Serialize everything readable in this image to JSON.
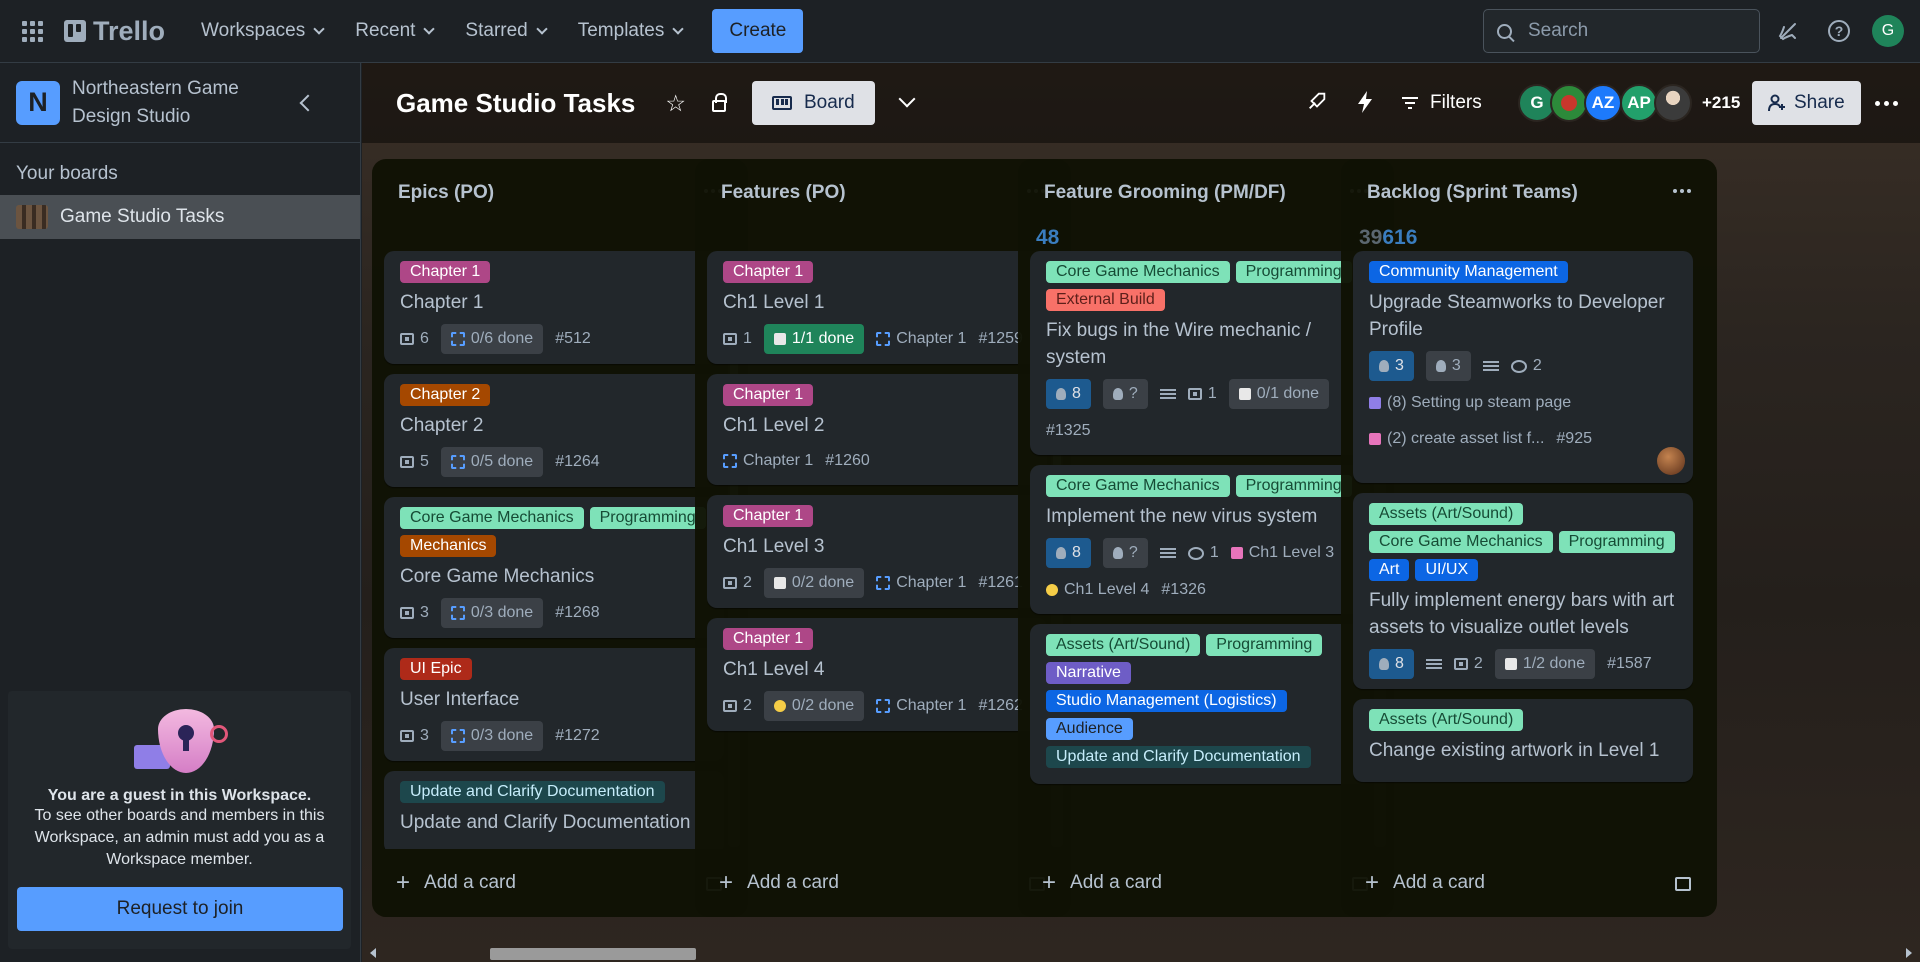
{
  "topnav": {
    "logo": "Trello",
    "menus": [
      {
        "label": "Workspaces"
      },
      {
        "label": "Recent"
      },
      {
        "label": "Starred"
      },
      {
        "label": "Templates"
      }
    ],
    "create_label": "Create",
    "search_placeholder": "Search",
    "user_initial": "G",
    "icons": [
      "apps-icon",
      "bell-icon",
      "help-icon"
    ]
  },
  "sidebar": {
    "workspace_initial": "N",
    "workspace_name": "Northeastern Game Design Studio",
    "your_boards": "Your boards",
    "boards": [
      {
        "label": "Game Studio Tasks"
      }
    ],
    "guest": {
      "title": "You are a guest in this Workspace.",
      "text": "To see other boards and members in this Workspace, an admin must add you as a Workspace member.",
      "button": "Request to join"
    }
  },
  "board": {
    "title": "Game Studio Tasks",
    "view_label": "Board",
    "filters_label": "Filters",
    "members": [
      "G",
      "",
      "AZ",
      "AP",
      ""
    ],
    "more_members": "+215",
    "share_label": "Share",
    "add_card_label": "Add a card",
    "lists": [
      {
        "title": "Epics (PO)",
        "count": "",
        "count2": "",
        "cards": [
          {
            "labels": [
              {
                "text": "Chapter 1",
                "color": "purple"
              }
            ],
            "title": "Chapter 1",
            "badges": [
              {
                "type": "cards",
                "text": "6"
              },
              {
                "type": "hier",
                "text": "0/6 done",
                "pill": "dark"
              },
              {
                "type": "text",
                "text": "#512"
              }
            ]
          },
          {
            "labels": [
              {
                "text": "Chapter 2",
                "color": "orange"
              }
            ],
            "title": "Chapter 2",
            "badges": [
              {
                "type": "cards",
                "text": "5"
              },
              {
                "type": "hier",
                "text": "0/5 done",
                "pill": "dark"
              },
              {
                "type": "text",
                "text": "#1264"
              }
            ]
          },
          {
            "labels": [
              {
                "text": "Core Game Mechanics",
                "color": "green"
              },
              {
                "text": "Programming",
                "color": "green"
              },
              {
                "text": "Mechanics",
                "color": "orange"
              }
            ],
            "title": "Core Game Mechanics",
            "badges": [
              {
                "type": "cards",
                "text": "3"
              },
              {
                "type": "hier",
                "text": "0/3 done",
                "pill": "dark"
              },
              {
                "type": "text",
                "text": "#1268"
              }
            ]
          },
          {
            "labels": [
              {
                "text": "UI Epic",
                "color": "redd"
              }
            ],
            "title": "User Interface",
            "badges": [
              {
                "type": "cards",
                "text": "3"
              },
              {
                "type": "hier",
                "text": "0/3 done",
                "pill": "dark"
              },
              {
                "type": "text",
                "text": "#1272"
              }
            ]
          },
          {
            "labels": [
              {
                "text": "Update and Clarify Documentation",
                "color": "teal"
              }
            ],
            "title": "Update and Clarify Documentation",
            "badges": []
          }
        ]
      },
      {
        "title": "Features (PO)",
        "count": "",
        "count2": "",
        "cards": [
          {
            "labels": [
              {
                "text": "Chapter 1",
                "color": "purple"
              }
            ],
            "title": "Ch1 Level 1",
            "badges": [
              {
                "type": "cards",
                "text": "1"
              },
              {
                "type": "check",
                "text": "1/1 done",
                "pill": "green"
              },
              {
                "type": "hier",
                "text": "Chapter 1"
              },
              {
                "type": "text",
                "text": "#1259"
              }
            ]
          },
          {
            "labels": [
              {
                "text": "Chapter 1",
                "color": "purple"
              }
            ],
            "title": "Ch1 Level 2",
            "badges": [
              {
                "type": "hier",
                "text": "Chapter 1"
              },
              {
                "type": "text",
                "text": "#1260"
              }
            ]
          },
          {
            "labels": [
              {
                "text": "Chapter 1",
                "color": "purple"
              }
            ],
            "title": "Ch1 Level 3",
            "badges": [
              {
                "type": "cards",
                "text": "2"
              },
              {
                "type": "check",
                "text": "0/2 done",
                "pill": "dark"
              },
              {
                "type": "hier",
                "text": "Chapter 1"
              },
              {
                "type": "text",
                "text": "#1261"
              }
            ]
          },
          {
            "labels": [
              {
                "text": "Chapter 1",
                "color": "purple"
              }
            ],
            "title": "Ch1 Level 4",
            "badges": [
              {
                "type": "cards",
                "text": "2"
              },
              {
                "type": "smile",
                "text": "0/2 done",
                "pill": "dark"
              },
              {
                "type": "hier",
                "text": "Chapter 1"
              },
              {
                "type": "text",
                "text": "#1262"
              }
            ]
          }
        ]
      },
      {
        "title": "Feature Grooming (PM/DF)",
        "count": "48",
        "count2": "",
        "cards": [
          {
            "labels": [
              {
                "text": "Core Game Mechanics",
                "color": "green"
              },
              {
                "text": "Programming",
                "color": "green"
              },
              {
                "text": "External Build",
                "color": "red"
              }
            ],
            "title": "Fix bugs in the Wire mechanic / system",
            "badges": [
              {
                "type": "points",
                "text": "8",
                "pill": "blue"
              },
              {
                "type": "points",
                "text": "?",
                "pill": "dark"
              },
              {
                "type": "desc",
                "text": ""
              },
              {
                "type": "cards",
                "text": "1"
              },
              {
                "type": "check",
                "text": "0/1 done",
                "pill": "dark"
              },
              {
                "type": "text",
                "text": "#1325"
              }
            ]
          },
          {
            "labels": [
              {
                "text": "Core Game Mechanics",
                "color": "green"
              },
              {
                "text": "Programming",
                "color": "green"
              }
            ],
            "title": "Implement the new virus system",
            "badges": [
              {
                "type": "points",
                "text": "8",
                "pill": "blue"
              },
              {
                "type": "points",
                "text": "?",
                "pill": "dark"
              },
              {
                "type": "desc",
                "text": ""
              },
              {
                "type": "comment",
                "text": "1"
              },
              {
                "type": "pin",
                "text": "Ch1 Level 3"
              },
              {
                "type": "smile",
                "text": "Ch1 Level 4"
              },
              {
                "type": "text",
                "text": "#1326"
              }
            ]
          },
          {
            "labels": [
              {
                "text": "Assets (Art/Sound)",
                "color": "green"
              },
              {
                "text": "Programming",
                "color": "green"
              },
              {
                "text": "Narrative",
                "color": "violet"
              },
              {
                "text": "Studio Management (Logistics)",
                "color": "royal"
              },
              {
                "text": "Audience",
                "color": "sky"
              },
              {
                "text": "Update and Clarify Documentation",
                "color": "teal"
              }
            ],
            "title": "",
            "badges": []
          }
        ]
      },
      {
        "title": "Backlog (Sprint Teams)",
        "count": "616",
        "count2": "39",
        "cards": [
          {
            "labels": [
              {
                "text": "Community Management",
                "color": "royal"
              }
            ],
            "title": "Upgrade Steamworks to Developer Profile",
            "badges": [
              {
                "type": "points",
                "text": "3",
                "pill": "blue"
              },
              {
                "type": "points",
                "text": "3",
                "pill": "dark"
              },
              {
                "type": "desc",
                "text": ""
              },
              {
                "type": "comment",
                "text": "2"
              },
              {
                "type": "link",
                "text": "(8) Setting up steam page"
              },
              {
                "type": "link2",
                "text": "(2) create asset list f..."
              },
              {
                "type": "text",
                "text": "#925"
              }
            ],
            "avatar": true
          },
          {
            "labels": [
              {
                "text": "Assets (Art/Sound)",
                "color": "green"
              },
              {
                "text": "Core Game Mechanics",
                "color": "green"
              },
              {
                "text": "Programming",
                "color": "green"
              },
              {
                "text": "Art",
                "color": "royal"
              },
              {
                "text": "UI/UX",
                "color": "royal"
              }
            ],
            "title": "Fully implement energy bars with art assets to visualize outlet levels",
            "badges": [
              {
                "type": "points",
                "text": "8",
                "pill": "blue"
              },
              {
                "type": "desc",
                "text": ""
              },
              {
                "type": "cards",
                "text": "2"
              },
              {
                "type": "check",
                "text": "1/2 done",
                "pill": "dark"
              },
              {
                "type": "text",
                "text": "#1587"
              }
            ]
          },
          {
            "labels": [
              {
                "text": "Assets (Art/Sound)",
                "color": "green"
              }
            ],
            "title": "Change existing artwork in Level 1",
            "badges": []
          }
        ]
      }
    ]
  }
}
